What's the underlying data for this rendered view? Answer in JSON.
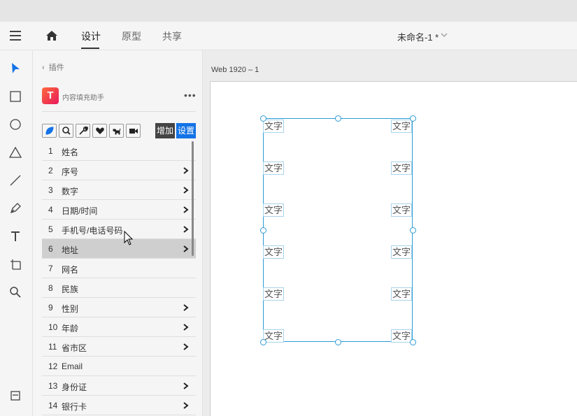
{
  "topbar": {
    "tabs": [
      {
        "label": "设计",
        "active": true
      },
      {
        "label": "原型",
        "active": false
      },
      {
        "label": "共享",
        "active": false
      }
    ],
    "doc_title": "未命名-1 *"
  },
  "tools": [
    "select-arrow-icon",
    "rectangle-icon",
    "ellipse-icon",
    "triangle-icon",
    "line-icon",
    "pen-icon",
    "text-icon",
    "artboard-icon",
    "zoom-icon"
  ],
  "plugin_panel": {
    "back_label": "插件",
    "plugin_name": "内容填充助手",
    "more_label": "•••",
    "toolbar_icons": [
      "leaf-icon",
      "search-icon",
      "wrench-icon",
      "heart-icon",
      "dog-icon",
      "video-icon"
    ],
    "add_label": "增加",
    "settings_label": "设置",
    "items": [
      {
        "num": "1",
        "label": "姓名",
        "arrow": false
      },
      {
        "num": "2",
        "label": "序号",
        "arrow": true
      },
      {
        "num": "3",
        "label": "数字",
        "arrow": true
      },
      {
        "num": "4",
        "label": "日期/时间",
        "arrow": true
      },
      {
        "num": "5",
        "label": "手机号/电话号码",
        "arrow": true
      },
      {
        "num": "6",
        "label": "地址",
        "arrow": true,
        "selected": true
      },
      {
        "num": "7",
        "label": "网名",
        "arrow": false
      },
      {
        "num": "8",
        "label": "民族",
        "arrow": false
      },
      {
        "num": "9",
        "label": "性别",
        "arrow": true
      },
      {
        "num": "10",
        "label": "年龄",
        "arrow": true
      },
      {
        "num": "11",
        "label": "省市区",
        "arrow": true
      },
      {
        "num": "12",
        "label": "Email",
        "arrow": false
      },
      {
        "num": "13",
        "label": "身份证",
        "arrow": true
      },
      {
        "num": "14",
        "label": "银行卡",
        "arrow": true
      }
    ]
  },
  "canvas": {
    "artboard_label": "Web 1920 – 1",
    "text_placeholder": "文字"
  },
  "colors": {
    "accent": "#1473e6",
    "selection": "#2c9bd6",
    "add_button": "#444444"
  }
}
